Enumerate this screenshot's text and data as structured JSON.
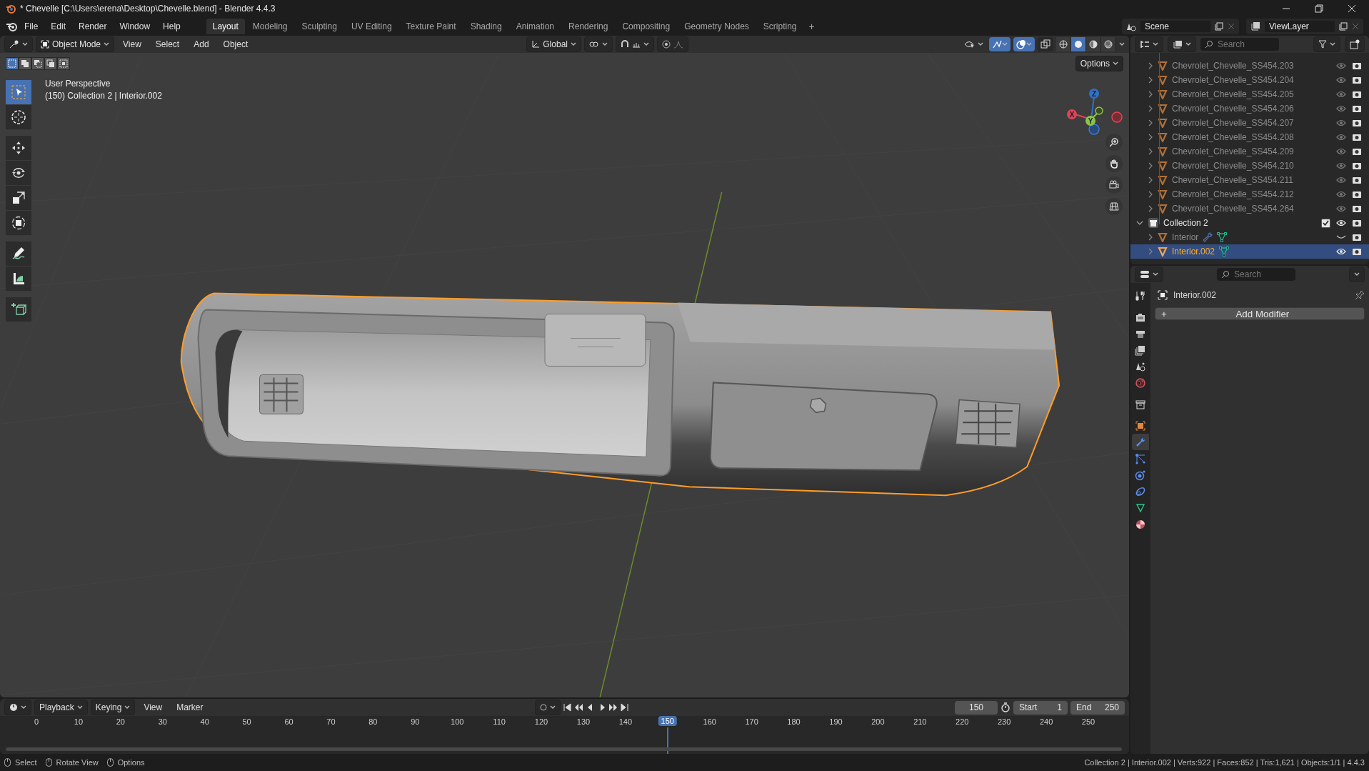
{
  "window": {
    "title": "* Chevelle [C:\\Users\\erena\\Desktop\\Chevelle.blend] - Blender 4.4.3"
  },
  "menu": [
    "File",
    "Edit",
    "Render",
    "Window",
    "Help"
  ],
  "workspaces": [
    {
      "label": "Layout",
      "selected": true
    },
    {
      "label": "Modeling",
      "selected": false
    },
    {
      "label": "Sculpting",
      "selected": false
    },
    {
      "label": "UV Editing",
      "selected": false
    },
    {
      "label": "Texture Paint",
      "selected": false
    },
    {
      "label": "Shading",
      "selected": false
    },
    {
      "label": "Animation",
      "selected": false
    },
    {
      "label": "Rendering",
      "selected": false
    },
    {
      "label": "Compositing",
      "selected": false
    },
    {
      "label": "Geometry Nodes",
      "selected": false
    },
    {
      "label": "Scripting",
      "selected": false
    }
  ],
  "add_workspace": "+",
  "scene": "Scene",
  "view_layer": "ViewLayer",
  "viewport": {
    "mode": "Object Mode",
    "snap_on": false,
    "proportional_on": false,
    "menus": [
      "View",
      "Select",
      "Add",
      "Object"
    ],
    "orientation": "Global",
    "options": "Options",
    "toggles": [
      {
        "kind": "gizmos",
        "on": true
      },
      {
        "kind": "overlays",
        "on": true
      },
      {
        "kind": "xray",
        "on": false
      }
    ],
    "shading": [
      {
        "kind": "wireframe",
        "selected": false
      },
      {
        "kind": "solid",
        "selected": true
      },
      {
        "kind": "material",
        "selected": false
      },
      {
        "kind": "rendered",
        "selected": false
      }
    ],
    "select_modes": [
      {
        "kind": "set",
        "selected": true
      },
      {
        "kind": "extend",
        "selected": false
      },
      {
        "kind": "subtract",
        "selected": false
      },
      {
        "kind": "invert",
        "selected": false
      },
      {
        "kind": "intersect",
        "selected": false
      }
    ],
    "tools": [
      {
        "kind": "select",
        "selected": true
      },
      {
        "kind": "cursor",
        "selected": false
      },
      {
        "kind": "move",
        "selected": false
      },
      {
        "kind": "rotate",
        "selected": false
      },
      {
        "kind": "scale",
        "selected": false
      },
      {
        "kind": "transform",
        "selected": false
      },
      {
        "kind": "annotate",
        "selected": false
      },
      {
        "kind": "measure",
        "selected": false
      },
      {
        "kind": "add_cube",
        "selected": false
      }
    ],
    "overlay_text": [
      "User Perspective",
      "(150) Collection 2 | Interior.002"
    ],
    "gizmo_axes": [
      "Z",
      "X",
      "Y"
    ]
  },
  "outliner": {
    "search": {
      "placeholder": "Search"
    },
    "items": [
      {
        "kind": "continued",
        "children": [
          {
            "kind": "object",
            "name": "Chevrolet_Chevelle_SS454.203",
            "expanded": false,
            "selected": false,
            "dimmed": true,
            "hidden": false,
            "modifier": false,
            "mesh_data": false
          },
          {
            "kind": "object",
            "name": "Chevrolet_Chevelle_SS454.204",
            "expanded": false,
            "selected": false,
            "dimmed": true,
            "hidden": false,
            "modifier": false,
            "mesh_data": false
          },
          {
            "kind": "object",
            "name": "Chevrolet_Chevelle_SS454.205",
            "expanded": false,
            "selected": false,
            "dimmed": true,
            "hidden": false,
            "modifier": false,
            "mesh_data": false
          },
          {
            "kind": "object",
            "name": "Chevrolet_Chevelle_SS454.206",
            "expanded": false,
            "selected": false,
            "dimmed": true,
            "hidden": false,
            "modifier": false,
            "mesh_data": false
          },
          {
            "kind": "object",
            "name": "Chevrolet_Chevelle_SS454.207",
            "expanded": false,
            "selected": false,
            "dimmed": true,
            "hidden": false,
            "modifier": false,
            "mesh_data": false
          },
          {
            "kind": "object",
            "name": "Chevrolet_Chevelle_SS454.208",
            "expanded": false,
            "selected": false,
            "dimmed": true,
            "hidden": false,
            "modifier": false,
            "mesh_data": false
          },
          {
            "kind": "object",
            "name": "Chevrolet_Chevelle_SS454.209",
            "expanded": false,
            "selected": false,
            "dimmed": true,
            "hidden": false,
            "modifier": false,
            "mesh_data": false
          },
          {
            "kind": "object",
            "name": "Chevrolet_Chevelle_SS454.210",
            "expanded": false,
            "selected": false,
            "dimmed": true,
            "hidden": false,
            "modifier": false,
            "mesh_data": false
          },
          {
            "kind": "object",
            "name": "Chevrolet_Chevelle_SS454.211",
            "expanded": false,
            "selected": false,
            "dimmed": true,
            "hidden": false,
            "modifier": false,
            "mesh_data": false
          },
          {
            "kind": "object",
            "name": "Chevrolet_Chevelle_SS454.212",
            "expanded": false,
            "selected": false,
            "dimmed": true,
            "hidden": false,
            "modifier": false,
            "mesh_data": false
          },
          {
            "kind": "object",
            "name": "Chevrolet_Chevelle_SS454.264",
            "expanded": false,
            "selected": false,
            "dimmed": true,
            "hidden": false,
            "modifier": false,
            "mesh_data": false
          }
        ]
      },
      {
        "kind": "collection",
        "name": "Collection 2",
        "expanded": true,
        "checked": true,
        "selected": false,
        "children": [
          {
            "kind": "object",
            "name": "Interior",
            "expanded": false,
            "selected": false,
            "dimmed": true,
            "hidden": true,
            "modifier": true,
            "mesh_data": true
          },
          {
            "kind": "object",
            "name": "Interior.002",
            "expanded": false,
            "selected": true,
            "dimmed": false,
            "hidden": false,
            "modifier": false,
            "mesh_data": true
          }
        ]
      }
    ]
  },
  "properties": {
    "search": {
      "placeholder": "Search"
    },
    "tabs": [
      {
        "kind": "tool",
        "selected": false
      },
      {
        "kind": "render",
        "selected": false
      },
      {
        "kind": "output",
        "selected": false
      },
      {
        "kind": "view_layer",
        "selected": false
      },
      {
        "kind": "scene",
        "selected": false
      },
      {
        "kind": "world",
        "selected": false
      },
      {
        "kind": "collection",
        "selected": false
      },
      {
        "kind": "object",
        "selected": false
      },
      {
        "kind": "modifiers",
        "selected": true
      },
      {
        "kind": "particles",
        "selected": false
      },
      {
        "kind": "physics",
        "selected": false
      },
      {
        "kind": "constraints",
        "selected": false
      },
      {
        "kind": "data",
        "selected": false
      },
      {
        "kind": "material",
        "selected": false
      }
    ],
    "object_name": "Interior.002",
    "add_button": "Add Modifier",
    "add_icon": "+"
  },
  "timeline": {
    "menus": [
      "Playback",
      "Keying",
      "View",
      "Marker"
    ],
    "current_frame": "150",
    "start_label": "Start",
    "start": "1",
    "end_label": "End",
    "end": "250",
    "ruler": [
      "0",
      "10",
      "20",
      "30",
      "40",
      "50",
      "60",
      "70",
      "80",
      "90",
      "100",
      "110",
      "120",
      "130",
      "140",
      "160",
      "170",
      "180",
      "190",
      "200",
      "210",
      "220",
      "230",
      "240",
      "250"
    ],
    "playhead": {
      "label": "150",
      "level": 0.6
    }
  },
  "status_bar": {
    "hints": [
      "Select",
      "Rotate View",
      "Options"
    ],
    "stats": "Collection 2 | Interior.002 | Verts:922 | Faces:852 | Tris:1,621 | Objects:1/1 | 4.4.3"
  }
}
